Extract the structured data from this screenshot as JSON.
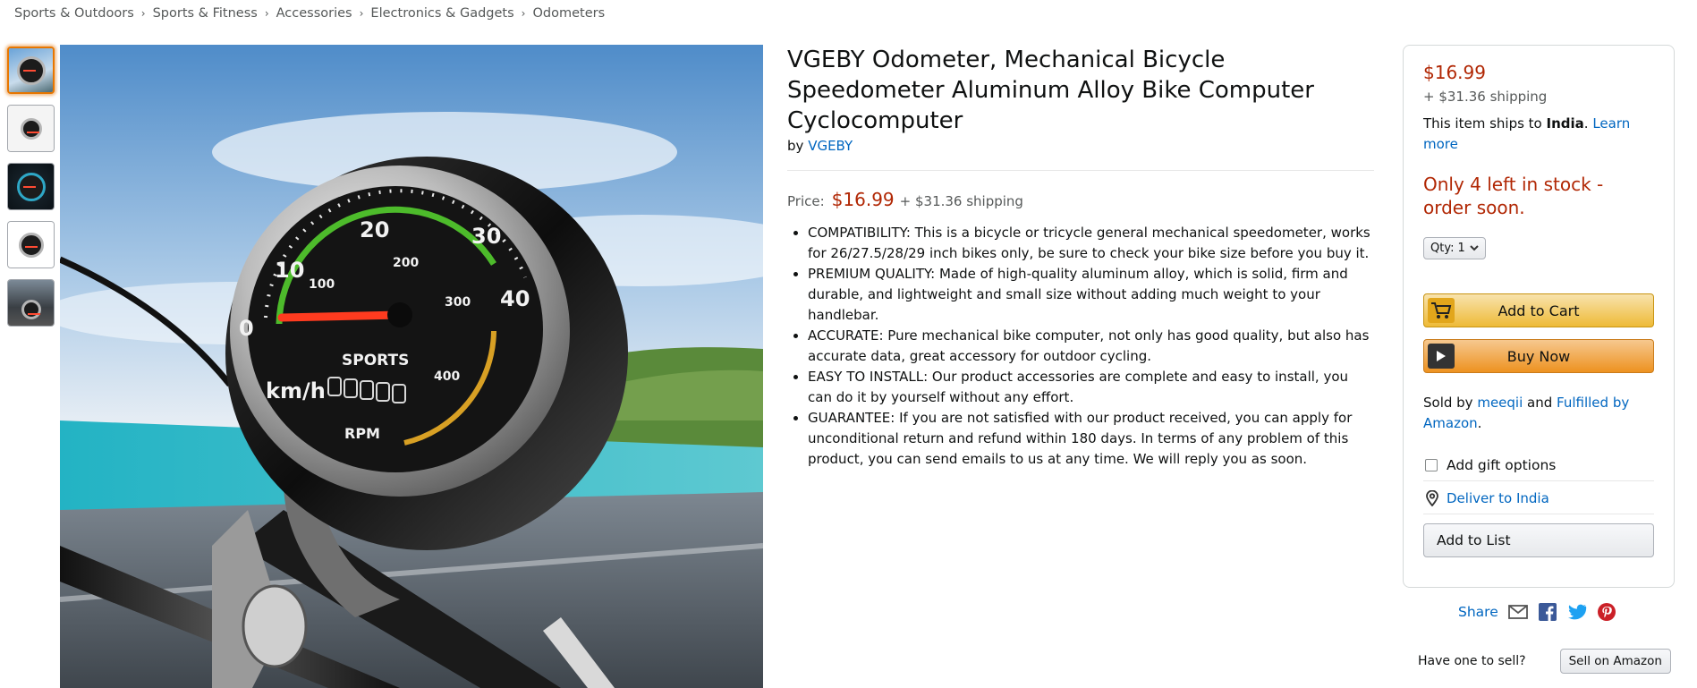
{
  "breadcrumb": [
    "Sports & Outdoors",
    "Sports & Fitness",
    "Accessories",
    "Electronics & Gadgets",
    "Odometers"
  ],
  "breadcrumb_separator": "›",
  "thumbnails": [
    {
      "name": "thumbnail-1",
      "active": true
    },
    {
      "name": "thumbnail-2",
      "active": false
    },
    {
      "name": "thumbnail-3",
      "active": false
    },
    {
      "name": "thumbnail-4",
      "active": false
    },
    {
      "name": "thumbnail-5",
      "active": false
    }
  ],
  "main_image": {
    "dial_numbers": [
      "0",
      "10",
      "20",
      "30",
      "40"
    ],
    "rpm_numbers": [
      "100",
      "200",
      "300",
      "400"
    ],
    "brand": "SPORTS",
    "unit": "km/h",
    "rpm_label": "RPM"
  },
  "product": {
    "title": "VGEBY Odometer, Mechanical Bicycle Speedometer Aluminum Alloy Bike Computer Cyclocomputer",
    "by_label": "by",
    "brand": "VGEBY",
    "price_label": "Price:",
    "price": "$16.99",
    "shipping": "+ $31.36 shipping",
    "bullets": [
      "COMPATIBILITY: This is a bicycle or tricycle general mechanical speedometer, works for 26/27.5/28/29 inch bikes only, be sure to check your bike size before you buy it.",
      "PREMIUM QUALITY: Made of high-quality aluminum alloy, which is solid, firm and durable, and lightweight and small size without adding much weight to your handlebar.",
      "ACCURATE: Pure mechanical bike computer, not only has good quality, but also has accurate data, great accessory for outdoor cycling.",
      "EASY TO INSTALL: Our product accessories are complete and easy to install, you can do it by yourself without any effort.",
      "GUARANTEE: If you are not satisfied with our product received, you can apply for unconditional return and refund within 180 days. In terms of any problem of this product, you can send emails to us at any time. We will reply you as soon."
    ]
  },
  "buybox": {
    "price": "$16.99",
    "shipping": "+ $31.36 shipping",
    "ships_prefix": "This item ships to ",
    "ships_country": "India",
    "ships_suffix": ". ",
    "learn_more": "Learn more",
    "stock": "Only 4 left in stock - order soon.",
    "qty_label": "Qty:",
    "qty_value": "1",
    "add_to_cart": "Add to Cart",
    "buy_now": "Buy Now",
    "sold_by_prefix": "Sold by ",
    "seller": "meeqii",
    "sold_and": " and ",
    "fulfilled": "Fulfilled by Amazon",
    "sold_suffix": ".",
    "gift": "Add gift options",
    "deliver": "Deliver to India",
    "add_to_list": "Add to List"
  },
  "share": {
    "label": "Share",
    "icons": [
      "email-icon",
      "facebook-icon",
      "twitter-icon",
      "pinterest-icon"
    ]
  },
  "sell": {
    "question": "Have one to sell?",
    "button": "Sell on Amazon"
  },
  "colors": {
    "price": "#b12704",
    "link": "#0066c0",
    "cart": "#f0c14b",
    "buy": "#f39c33",
    "active_thumb": "#e77600"
  }
}
